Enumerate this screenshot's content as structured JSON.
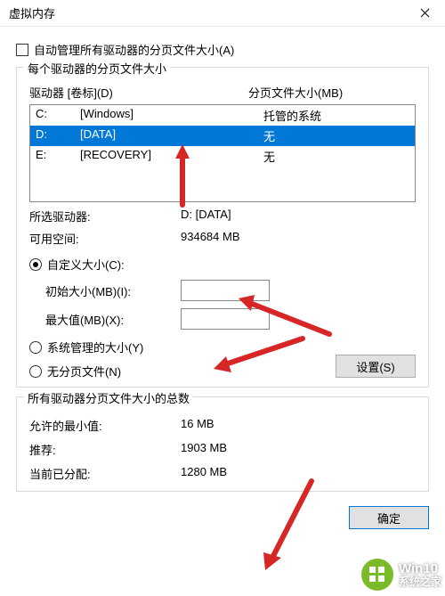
{
  "window": {
    "title": "虚拟内存"
  },
  "auto_manage": {
    "label": "自动管理所有驱动器的分页文件大小(A)",
    "checked": false
  },
  "perdrive": {
    "legend": "每个驱动器的分页文件大小",
    "header_drive": "驱动器 [卷标](D)",
    "header_size": "分页文件大小(MB)",
    "rows": [
      {
        "letter": "C:",
        "label": "[Windows]",
        "size": "托管的系统",
        "selected": false
      },
      {
        "letter": "D:",
        "label": "[DATA]",
        "size": "无",
        "selected": true
      },
      {
        "letter": "E:",
        "label": "[RECOVERY]",
        "size": "无",
        "selected": false
      }
    ],
    "selected_label": "所选驱动器:",
    "selected_value": "D:  [DATA]",
    "free_label": "可用空间:",
    "free_value": "934684 MB",
    "radio_custom": "自定义大小(C):",
    "initial_label": "初始大小(MB)(I):",
    "initial_value": "",
    "max_label": "最大值(MB)(X):",
    "max_value": "",
    "radio_system": "系统管理的大小(Y)",
    "radio_none": "无分页文件(N)",
    "set_btn": "设置(S)"
  },
  "totals": {
    "legend": "所有驱动器分页文件大小的总数",
    "min_label": "允许的最小值:",
    "min_value": "16 MB",
    "rec_label": "推荐:",
    "rec_value": "1903 MB",
    "cur_label": "当前已分配:",
    "cur_value": "1280 MB"
  },
  "footer": {
    "ok": "确定"
  },
  "watermark": {
    "line1": "Win10",
    "line2": "系统之家"
  }
}
